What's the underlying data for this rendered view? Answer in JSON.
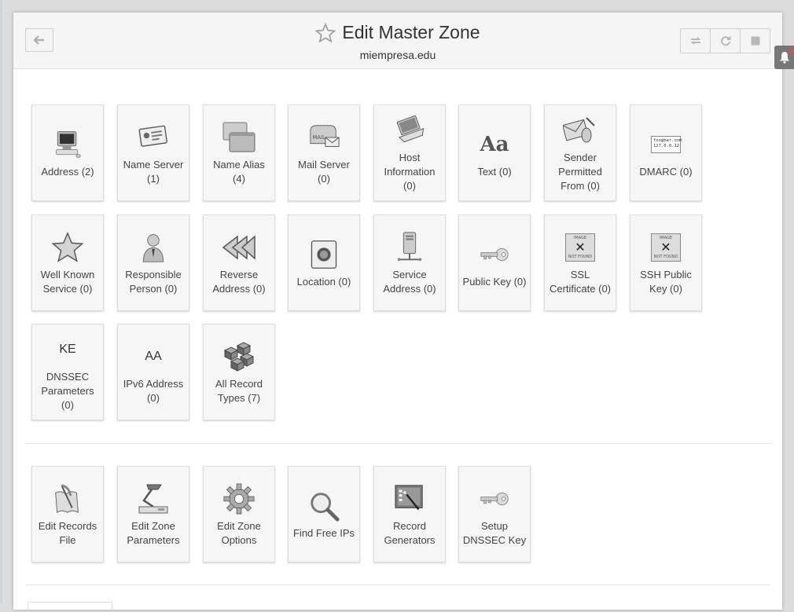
{
  "header": {
    "title": "Edit Master Zone",
    "subtitle": "miempresa.edu"
  },
  "record_types": [
    {
      "label": "Address (2)",
      "icon": "computer-icon"
    },
    {
      "label": "Name Server (1)",
      "icon": "id-card-icon"
    },
    {
      "label": "Name Alias (4)",
      "icon": "stacked-windows-icon"
    },
    {
      "label": "Mail Server (0)",
      "icon": "mailbox-icon"
    },
    {
      "label": "Host Information (0)",
      "icon": "laptop-icon"
    },
    {
      "label": "Text (0)",
      "icon": "text-aa-icon",
      "glyph": "Aa"
    },
    {
      "label": "Sender Permitted From (0)",
      "icon": "envelope-mouse-icon"
    },
    {
      "label": "DMARC (0)",
      "icon": "address-label-icon",
      "lines": [
        "foo@bar.com",
        "127.0.0.12"
      ]
    },
    {
      "label": "Well Known Service (0)",
      "icon": "star-icon"
    },
    {
      "label": "Responsible Person (0)",
      "icon": "person-icon"
    },
    {
      "label": "Reverse Address (0)",
      "icon": "rewind-icon"
    },
    {
      "label": "Location (0)",
      "icon": "location-globe-icon"
    },
    {
      "label": "Service Address (0)",
      "icon": "network-server-icon"
    },
    {
      "label": "Public Key (0)",
      "icon": "key-icon"
    },
    {
      "label": "SSL Certificate (0)",
      "icon": "image-not-found-icon",
      "top_text": "IMAGE",
      "bottom_text": "NOT FOUND"
    },
    {
      "label": "SSH Public Key (0)",
      "icon": "image-not-found-icon",
      "top_text": "IMAGE",
      "bottom_text": "NOT FOUND"
    },
    {
      "label": "DNSSEC Parameters (0)",
      "icon": "ke-glyph-icon",
      "glyph": "KE"
    },
    {
      "label": "IPv6 Address (0)",
      "icon": "aa-glyph-icon",
      "glyph": "AA"
    },
    {
      "label": "All Record Types (7)",
      "icon": "cubes-icon"
    }
  ],
  "actions": [
    {
      "label": "Edit Records File",
      "icon": "quill-paper-icon"
    },
    {
      "label": "Edit Zone Parameters",
      "icon": "desk-lamp-icon"
    },
    {
      "label": "Edit Zone Options",
      "icon": "gear-icon"
    },
    {
      "label": "Find Free IPs",
      "icon": "magnifier-icon"
    },
    {
      "label": "Record Generators",
      "icon": "magic-wand-board-icon"
    },
    {
      "label": "Setup DNSSEC Key",
      "icon": "key-icon"
    }
  ],
  "colors": {
    "panel_bg": "#ffffff",
    "header_bg": "#f5f5f5",
    "tile_bg": "#f6f6f6",
    "notification_dot": "#d9534f"
  }
}
